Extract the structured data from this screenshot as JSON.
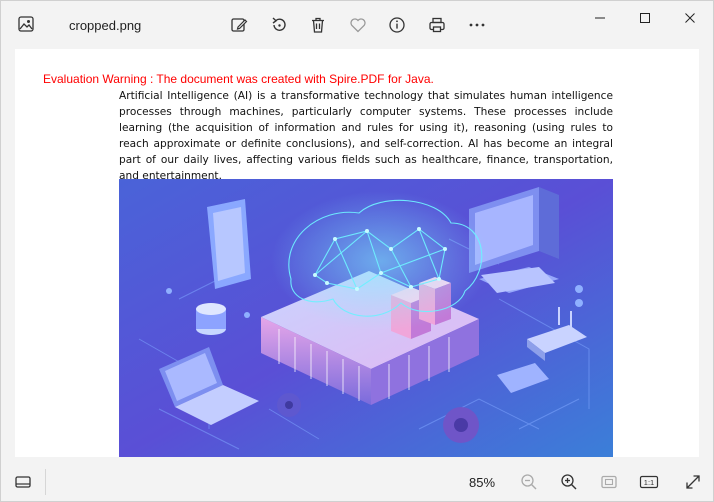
{
  "window": {
    "title": "cropped.png"
  },
  "toolbar": {
    "icons": [
      "edit-icon",
      "rotate-icon",
      "delete-icon",
      "favorite-icon",
      "info-icon",
      "print-icon",
      "more-icon"
    ]
  },
  "document": {
    "warning": "Evaluation Warning : The document was created with Spire.PDF for Java.",
    "paragraph": "Artificial Intelligence (AI) is a transformative technology that simulates human intelligence processes through machines, particularly computer systems. These processes include learning (the acquisition of information and rules for using it), reasoning (using rules to reach approximate or definite conclusions), and self-correction. AI has become an integral part of our daily lives, affecting various fields such as healthcare, finance, transportation, and entertainment."
  },
  "statusbar": {
    "zoom": "85%",
    "actual_size_label": "1:1"
  },
  "colors": {
    "warning": "#ff0000",
    "chrome": "#f3f3f3",
    "illustration_top": "#5b5fe0",
    "illustration_bottom": "#3a7bd5"
  }
}
